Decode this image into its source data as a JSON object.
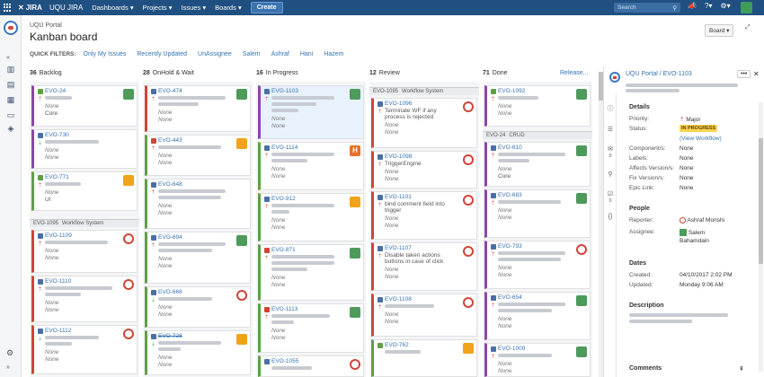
{
  "topnav": {
    "logo": "JIRA",
    "instance": "UQU JIRA",
    "menus": [
      "Dashboards",
      "Projects",
      "Issues",
      "Boards"
    ],
    "create_label": "Create",
    "search_placeholder": "Search"
  },
  "header": {
    "breadcrumb": "UQU Portal",
    "title": "Kanban board",
    "board_button": "Board",
    "quick_filters_label": "QUICK FILTERS:",
    "quick_filters": [
      "Only My Issues",
      "Recently Updated",
      "UnAssignee",
      "Salem",
      "Ashraf",
      "Hani",
      "Hazem"
    ]
  },
  "columns": [
    {
      "count": "36",
      "name": "Backlog"
    },
    {
      "count": "28",
      "name": "OnHold & Wait"
    },
    {
      "count": "16",
      "name": "In Progress"
    },
    {
      "count": "12",
      "name": "Review"
    },
    {
      "count": "71",
      "name": "Done"
    }
  ],
  "release_label": "Release...",
  "cards": {
    "c0": [
      {
        "key": "EVO-24",
        "f1": "None",
        "f2": "Core"
      },
      {
        "key": "EVO-730",
        "f1": "None",
        "f2": "None"
      },
      {
        "key": "EVO-771",
        "f1": "None",
        "f2": "UI"
      },
      {
        "key": "EVO-1109",
        "f1": "None",
        "f2": "None"
      },
      {
        "key": "EVO-1110",
        "f1": "None",
        "f2": "None"
      },
      {
        "key": "EVO-1112",
        "f1": "None",
        "f2": "None"
      }
    ],
    "c1": [
      {
        "key": "EVO-474",
        "f1": "None",
        "f2": "None"
      },
      {
        "key": "EVO-443",
        "f1": "None",
        "f2": "None"
      },
      {
        "key": "EVO-648",
        "f1": "None",
        "f2": "None"
      },
      {
        "key": "EVO-694",
        "f1": "None",
        "f2": "None"
      },
      {
        "key": "EVO-666",
        "f1": "None",
        "f2": "None"
      },
      {
        "key": "EVO-728",
        "f1": "None",
        "f2": "None"
      }
    ],
    "c2": [
      {
        "key": "EVO-1103",
        "f1": "None",
        "f2": "None"
      },
      {
        "key": "EVO-1114",
        "f1": "None",
        "f2": "None"
      },
      {
        "key": "EVO-912",
        "f1": "None",
        "f2": "None"
      },
      {
        "key": "EVO-871",
        "f1": "None",
        "f2": "None"
      },
      {
        "key": "EVO-1113",
        "f1": "None",
        "f2": "None"
      },
      {
        "key": "EVO-1055",
        "f1": "None",
        "f2": "None"
      }
    ],
    "c3": [
      {
        "key": "EVO-1096",
        "summary": "Terminate WF if any process is rejected",
        "f1": "None",
        "f2": "None"
      },
      {
        "key": "EVO-1098",
        "summary": "TriggerEngine",
        "f1": "None",
        "f2": "None"
      },
      {
        "key": "EVO-1101",
        "summary": "bind comment field into trigger",
        "f1": "None",
        "f2": "None"
      },
      {
        "key": "EVO-1107",
        "summary": "Disable taken actions buttons in case of click",
        "f1": "None",
        "f2": "None"
      },
      {
        "key": "EVO-1108",
        "f1": "None",
        "f2": "None"
      },
      {
        "key": "EVO-762"
      }
    ],
    "c4": [
      {
        "key": "EVO-1092",
        "f1": "None",
        "f2": "None"
      },
      {
        "key": "EVO-610",
        "f1": "None",
        "f2": "Core"
      },
      {
        "key": "EVO-683",
        "f1": "None",
        "f2": "None"
      },
      {
        "key": "EVO-793",
        "f1": "None",
        "f2": "None"
      },
      {
        "key": "EVO-654",
        "f1": "None",
        "f2": "None"
      },
      {
        "key": "EVO-1009",
        "f1": "None",
        "f2": "None"
      }
    ]
  },
  "swimlanes": [
    {
      "key": "EVO-1095",
      "name": "Workflow System"
    },
    {
      "key": "EVO-1095",
      "name": "Workflow System"
    },
    {
      "key": "EVO-24",
      "name": "CRUD"
    }
  ],
  "detail": {
    "breadcrumb": "UQU Portal / EVO-1103",
    "more_label": "•••",
    "details_heading": "Details",
    "fields": [
      {
        "label": "Priority:",
        "value": "Major"
      },
      {
        "label": "Status:",
        "value": "IN PROGRESS"
      },
      {
        "label": "",
        "value": "(View Workflow)"
      },
      {
        "label": "Component/s:",
        "value": "None"
      },
      {
        "label": "Labels:",
        "value": "None"
      },
      {
        "label": "Affects Version/s:",
        "value": "None"
      },
      {
        "label": "Fix Version/s:",
        "value": "None"
      },
      {
        "label": "Epic Link:",
        "value": "None"
      }
    ],
    "people_heading": "People",
    "reporter_label": "Reporter:",
    "reporter": "Ashraf Monshi",
    "assignee_label": "Assignee:",
    "assignee": "Salem Bahamdain",
    "dates_heading": "Dates",
    "created_label": "Created:",
    "created": "04/10/2017 2:02 PM",
    "updated_label": "Updated:",
    "updated": "Monday 9:06 AM",
    "description_heading": "Description",
    "comments_heading": "Comments",
    "rail_counts": [
      "0",
      "0"
    ]
  }
}
